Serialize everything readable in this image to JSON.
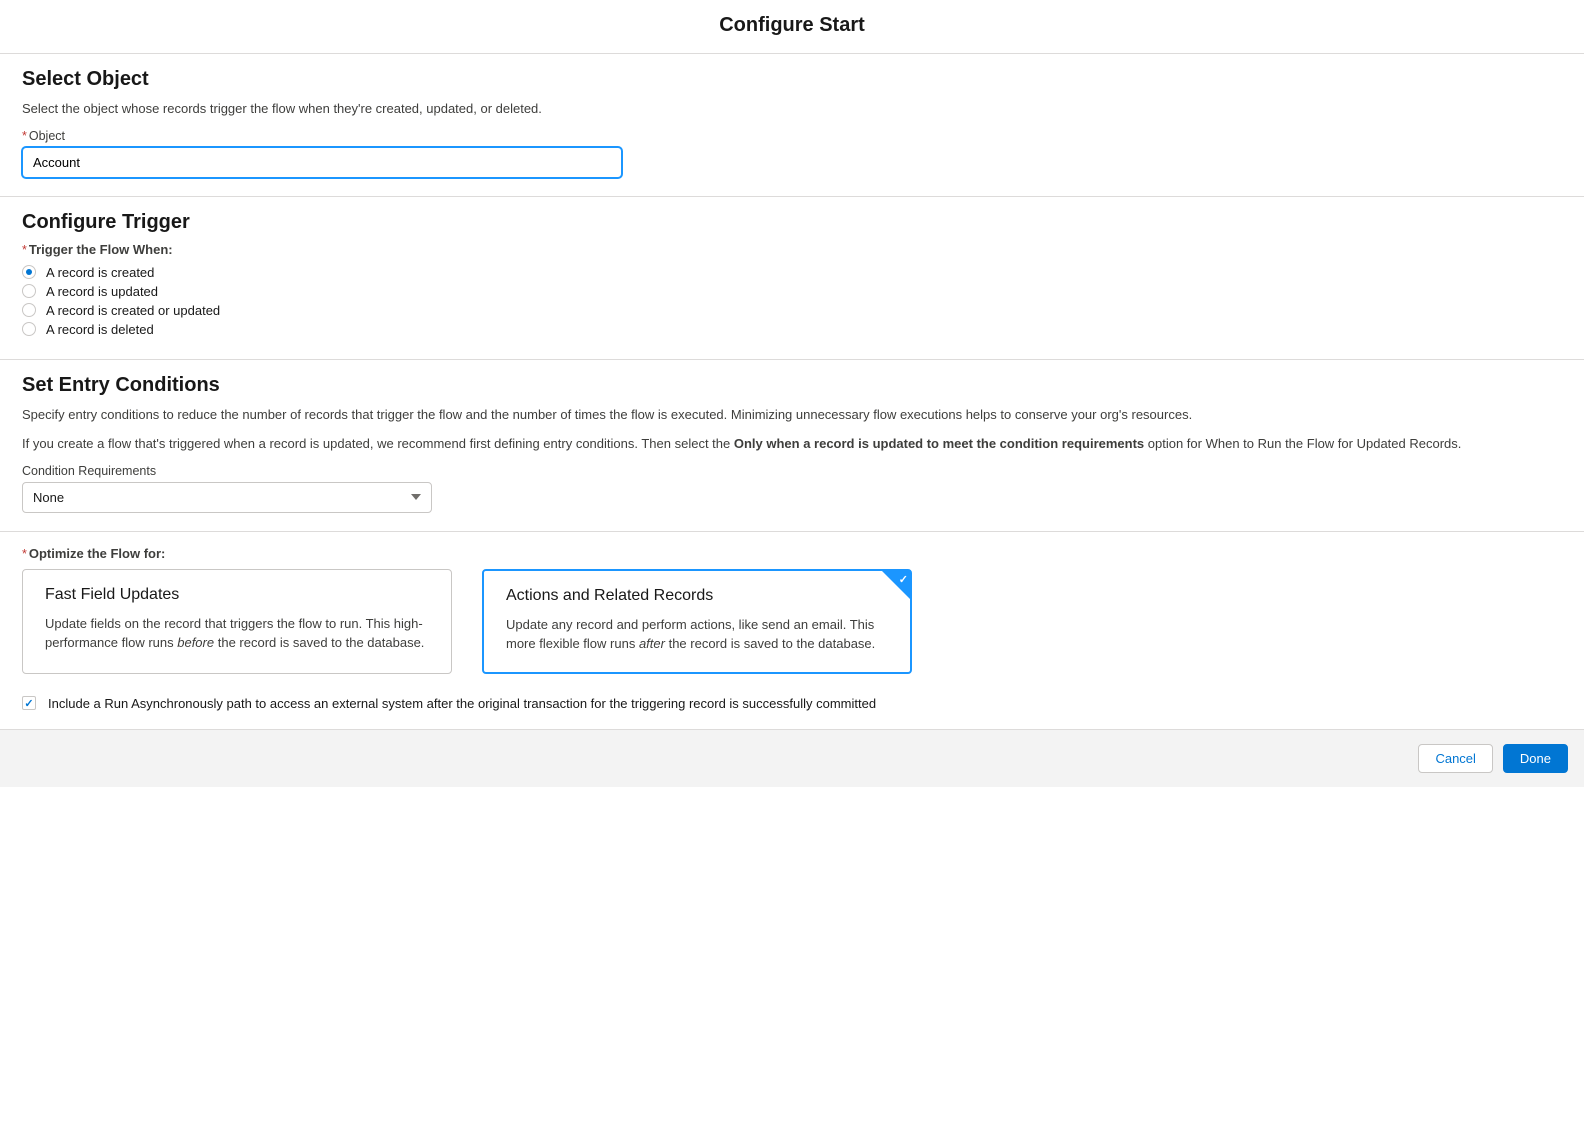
{
  "header": {
    "title": "Configure Start"
  },
  "selectObject": {
    "title": "Select Object",
    "description": "Select the object whose records trigger the flow when they're created, updated, or deleted.",
    "fieldLabel": "Object",
    "value": "Account"
  },
  "configureTrigger": {
    "title": "Configure Trigger",
    "label": "Trigger the Flow When:",
    "options": [
      {
        "label": "A record is created",
        "selected": true
      },
      {
        "label": "A record is updated",
        "selected": false
      },
      {
        "label": "A record is created or updated",
        "selected": false
      },
      {
        "label": "A record is deleted",
        "selected": false
      }
    ]
  },
  "entryConditions": {
    "title": "Set Entry Conditions",
    "desc1": "Specify entry conditions to reduce the number of records that trigger the flow and the number of times the flow is executed. Minimizing unnecessary flow executions helps to conserve your org's resources.",
    "desc2_pre": "If you create a flow that's triggered when a record is updated, we recommend first defining entry conditions. Then select the ",
    "desc2_bold": "Only when a record is updated to meet the condition requirements",
    "desc2_post": " option for When to Run the Flow for Updated Records.",
    "conditionLabel": "Condition Requirements",
    "conditionValue": "None"
  },
  "optimize": {
    "label": "Optimize the Flow for:",
    "cards": [
      {
        "title": "Fast Field Updates",
        "desc_pre": "Update fields on the record that triggers the flow to run. This high-performance flow runs ",
        "desc_em": "before",
        "desc_post": " the record is saved to the database.",
        "selected": false
      },
      {
        "title": "Actions and Related Records",
        "desc_pre": "Update any record and perform actions, like send an email. This more flexible flow runs ",
        "desc_em": "after",
        "desc_post": " the record is saved to the database.",
        "selected": true
      }
    ],
    "asyncCheckbox": {
      "checked": true,
      "label": "Include a Run Asynchronously path to access an external system after the original transaction for the triggering record is successfully committed"
    }
  },
  "footer": {
    "cancel": "Cancel",
    "done": "Done"
  }
}
